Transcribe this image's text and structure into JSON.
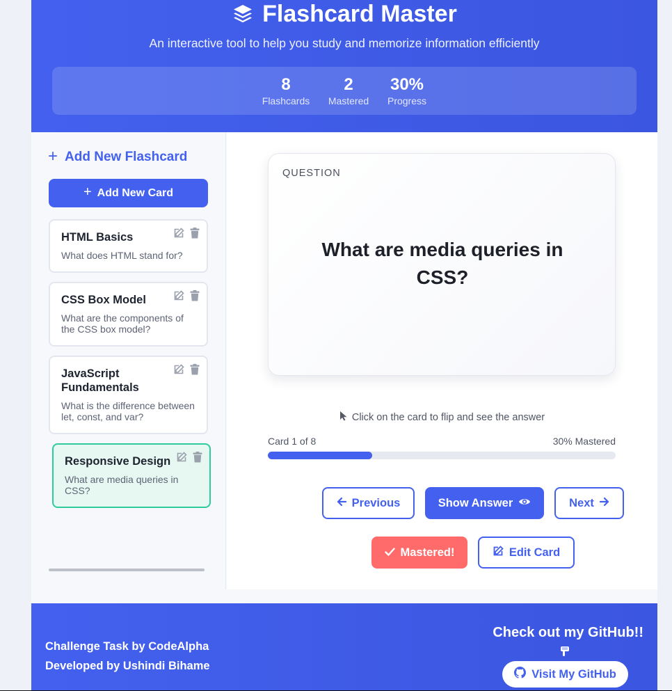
{
  "header": {
    "title": "Flashcard Master",
    "subtitle": "An interactive tool to help you study and memorize information efficiently",
    "stats": [
      {
        "value": "8",
        "label": "Flashcards"
      },
      {
        "value": "2",
        "label": "Mastered"
      },
      {
        "value": "30%",
        "label": "Progress"
      }
    ]
  },
  "sidebar": {
    "heading": "Add New Flashcard",
    "add_button": "Add New Card",
    "cards": [
      {
        "title": "HTML Basics",
        "question": "What does HTML stand for?"
      },
      {
        "title": "CSS Box Model",
        "question": "What are the components of the CSS box model?"
      },
      {
        "title": "JavaScript Fundamentals",
        "question": "What is the difference between let, const, and var?"
      },
      {
        "title": "Responsive Design",
        "question": "What are media queries in CSS?"
      }
    ]
  },
  "main": {
    "card_label": "QUESTION",
    "card_text": "What are media queries in CSS?",
    "hint": "Click on the card to flip and see the answer",
    "progress_text": "Card 1 of 8",
    "mastered_text": "30% Mastered",
    "progress_fraction": 0.3,
    "buttons": {
      "previous": "Previous",
      "show_answer": "Show Answer",
      "next": "Next",
      "mastered": "Mastered!",
      "edit": "Edit Card"
    }
  },
  "footer": {
    "line1": "Challenge Task by CodeAlpha",
    "line2": "Developed by Ushindi Bihame",
    "cta_title": "Check out my GitHub!!",
    "github_button": "Visit My GitHub"
  },
  "colors": {
    "primary": "#4361ee",
    "danger": "#ff6b6b",
    "active_border": "#2ecc9a",
    "active_bg": "#e6f8f1"
  },
  "icons": {
    "logo": "layer-group-icon",
    "plus": "plus-icon",
    "edit": "edit-icon",
    "delete": "trash-icon",
    "pointer": "mouse-pointer-icon",
    "previous": "arrow-left-icon",
    "show": "eye-icon",
    "next": "arrow-right-icon",
    "check": "check-icon",
    "github": "github-icon"
  }
}
